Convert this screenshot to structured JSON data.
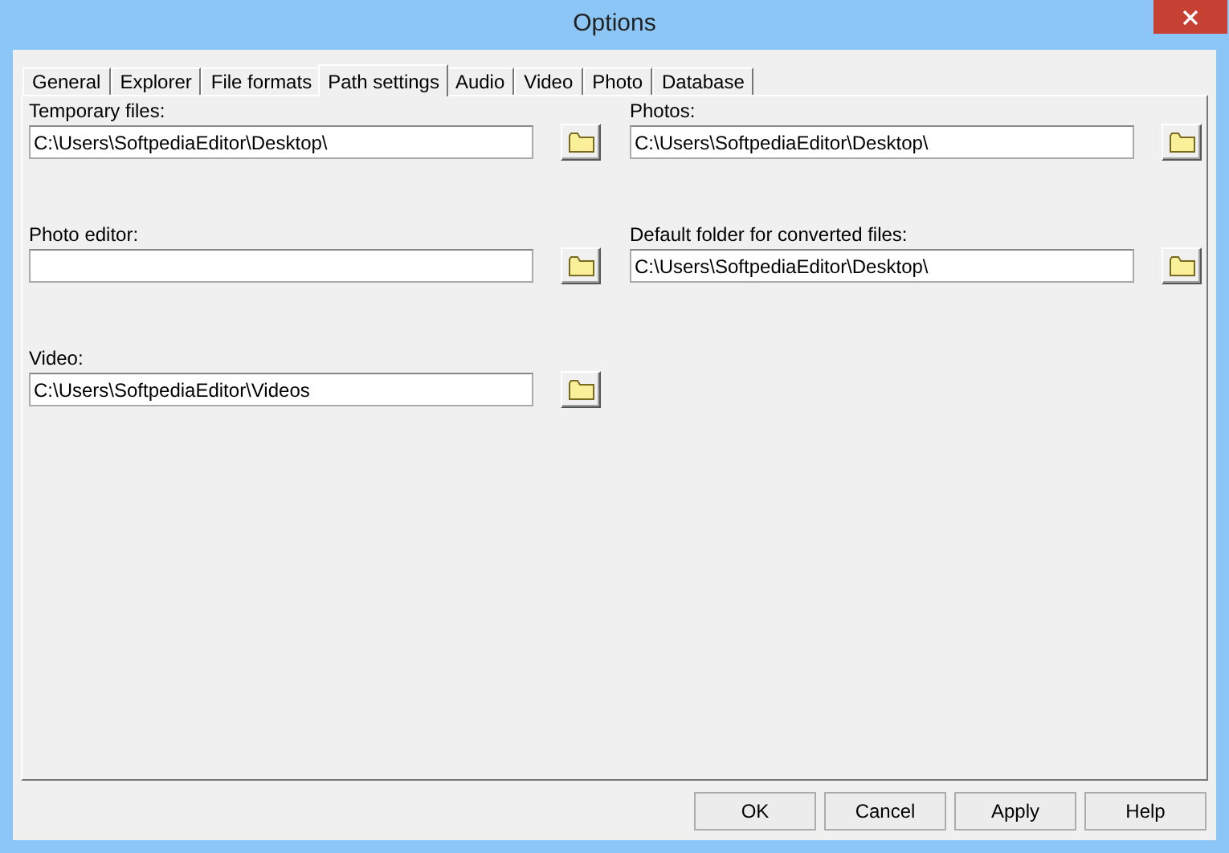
{
  "window": {
    "title": "Options"
  },
  "tabs": [
    {
      "label": "General",
      "selected": false
    },
    {
      "label": "Explorer",
      "selected": false
    },
    {
      "label": "File formats",
      "selected": false
    },
    {
      "label": "Path settings",
      "selected": true
    },
    {
      "label": "Audio",
      "selected": false
    },
    {
      "label": "Video",
      "selected": false
    },
    {
      "label": "Photo",
      "selected": false
    },
    {
      "label": "Database",
      "selected": false
    }
  ],
  "left_fields": [
    {
      "label": "Temporary files:",
      "value": "C:\\Users\\SoftpediaEditor\\Desktop\\"
    },
    {
      "label": "Photo editor:"
    },
    {
      "label": "Video:",
      "value": "C:\\Users\\SoftpediaEditor\\Videos"
    }
  ],
  "right_fields": [
    {
      "label": "Photos:",
      "value": "C:\\Users\\SoftpediaEditor\\Desktop\\"
    },
    {
      "label": "Default folder for converted files:",
      "value": "C:\\Users\\SoftpediaEditor\\Desktop\\"
    }
  ],
  "buttons": [
    "OK",
    "Cancel",
    "Apply",
    "Help"
  ]
}
